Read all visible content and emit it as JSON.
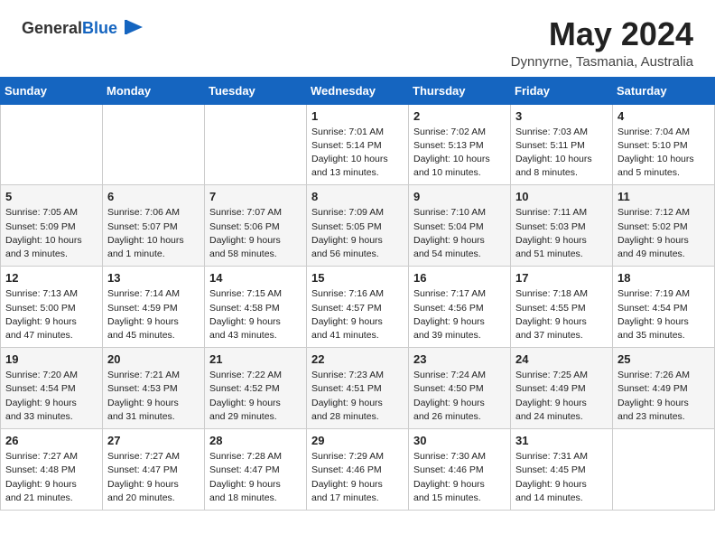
{
  "header": {
    "logo_general": "General",
    "logo_blue": "Blue",
    "month_title": "May 2024",
    "location": "Dynnyrne, Tasmania, Australia"
  },
  "days_of_week": [
    "Sunday",
    "Monday",
    "Tuesday",
    "Wednesday",
    "Thursday",
    "Friday",
    "Saturday"
  ],
  "weeks": [
    [
      {
        "day": "",
        "info": ""
      },
      {
        "day": "",
        "info": ""
      },
      {
        "day": "",
        "info": ""
      },
      {
        "day": "1",
        "info": "Sunrise: 7:01 AM\nSunset: 5:14 PM\nDaylight: 10 hours\nand 13 minutes."
      },
      {
        "day": "2",
        "info": "Sunrise: 7:02 AM\nSunset: 5:13 PM\nDaylight: 10 hours\nand 10 minutes."
      },
      {
        "day": "3",
        "info": "Sunrise: 7:03 AM\nSunset: 5:11 PM\nDaylight: 10 hours\nand 8 minutes."
      },
      {
        "day": "4",
        "info": "Sunrise: 7:04 AM\nSunset: 5:10 PM\nDaylight: 10 hours\nand 5 minutes."
      }
    ],
    [
      {
        "day": "5",
        "info": "Sunrise: 7:05 AM\nSunset: 5:09 PM\nDaylight: 10 hours\nand 3 minutes."
      },
      {
        "day": "6",
        "info": "Sunrise: 7:06 AM\nSunset: 5:07 PM\nDaylight: 10 hours\nand 1 minute."
      },
      {
        "day": "7",
        "info": "Sunrise: 7:07 AM\nSunset: 5:06 PM\nDaylight: 9 hours\nand 58 minutes."
      },
      {
        "day": "8",
        "info": "Sunrise: 7:09 AM\nSunset: 5:05 PM\nDaylight: 9 hours\nand 56 minutes."
      },
      {
        "day": "9",
        "info": "Sunrise: 7:10 AM\nSunset: 5:04 PM\nDaylight: 9 hours\nand 54 minutes."
      },
      {
        "day": "10",
        "info": "Sunrise: 7:11 AM\nSunset: 5:03 PM\nDaylight: 9 hours\nand 51 minutes."
      },
      {
        "day": "11",
        "info": "Sunrise: 7:12 AM\nSunset: 5:02 PM\nDaylight: 9 hours\nand 49 minutes."
      }
    ],
    [
      {
        "day": "12",
        "info": "Sunrise: 7:13 AM\nSunset: 5:00 PM\nDaylight: 9 hours\nand 47 minutes."
      },
      {
        "day": "13",
        "info": "Sunrise: 7:14 AM\nSunset: 4:59 PM\nDaylight: 9 hours\nand 45 minutes."
      },
      {
        "day": "14",
        "info": "Sunrise: 7:15 AM\nSunset: 4:58 PM\nDaylight: 9 hours\nand 43 minutes."
      },
      {
        "day": "15",
        "info": "Sunrise: 7:16 AM\nSunset: 4:57 PM\nDaylight: 9 hours\nand 41 minutes."
      },
      {
        "day": "16",
        "info": "Sunrise: 7:17 AM\nSunset: 4:56 PM\nDaylight: 9 hours\nand 39 minutes."
      },
      {
        "day": "17",
        "info": "Sunrise: 7:18 AM\nSunset: 4:55 PM\nDaylight: 9 hours\nand 37 minutes."
      },
      {
        "day": "18",
        "info": "Sunrise: 7:19 AM\nSunset: 4:54 PM\nDaylight: 9 hours\nand 35 minutes."
      }
    ],
    [
      {
        "day": "19",
        "info": "Sunrise: 7:20 AM\nSunset: 4:54 PM\nDaylight: 9 hours\nand 33 minutes."
      },
      {
        "day": "20",
        "info": "Sunrise: 7:21 AM\nSunset: 4:53 PM\nDaylight: 9 hours\nand 31 minutes."
      },
      {
        "day": "21",
        "info": "Sunrise: 7:22 AM\nSunset: 4:52 PM\nDaylight: 9 hours\nand 29 minutes."
      },
      {
        "day": "22",
        "info": "Sunrise: 7:23 AM\nSunset: 4:51 PM\nDaylight: 9 hours\nand 28 minutes."
      },
      {
        "day": "23",
        "info": "Sunrise: 7:24 AM\nSunset: 4:50 PM\nDaylight: 9 hours\nand 26 minutes."
      },
      {
        "day": "24",
        "info": "Sunrise: 7:25 AM\nSunset: 4:49 PM\nDaylight: 9 hours\nand 24 minutes."
      },
      {
        "day": "25",
        "info": "Sunrise: 7:26 AM\nSunset: 4:49 PM\nDaylight: 9 hours\nand 23 minutes."
      }
    ],
    [
      {
        "day": "26",
        "info": "Sunrise: 7:27 AM\nSunset: 4:48 PM\nDaylight: 9 hours\nand 21 minutes."
      },
      {
        "day": "27",
        "info": "Sunrise: 7:27 AM\nSunset: 4:47 PM\nDaylight: 9 hours\nand 20 minutes."
      },
      {
        "day": "28",
        "info": "Sunrise: 7:28 AM\nSunset: 4:47 PM\nDaylight: 9 hours\nand 18 minutes."
      },
      {
        "day": "29",
        "info": "Sunrise: 7:29 AM\nSunset: 4:46 PM\nDaylight: 9 hours\nand 17 minutes."
      },
      {
        "day": "30",
        "info": "Sunrise: 7:30 AM\nSunset: 4:46 PM\nDaylight: 9 hours\nand 15 minutes."
      },
      {
        "day": "31",
        "info": "Sunrise: 7:31 AM\nSunset: 4:45 PM\nDaylight: 9 hours\nand 14 minutes."
      },
      {
        "day": "",
        "info": ""
      }
    ]
  ]
}
